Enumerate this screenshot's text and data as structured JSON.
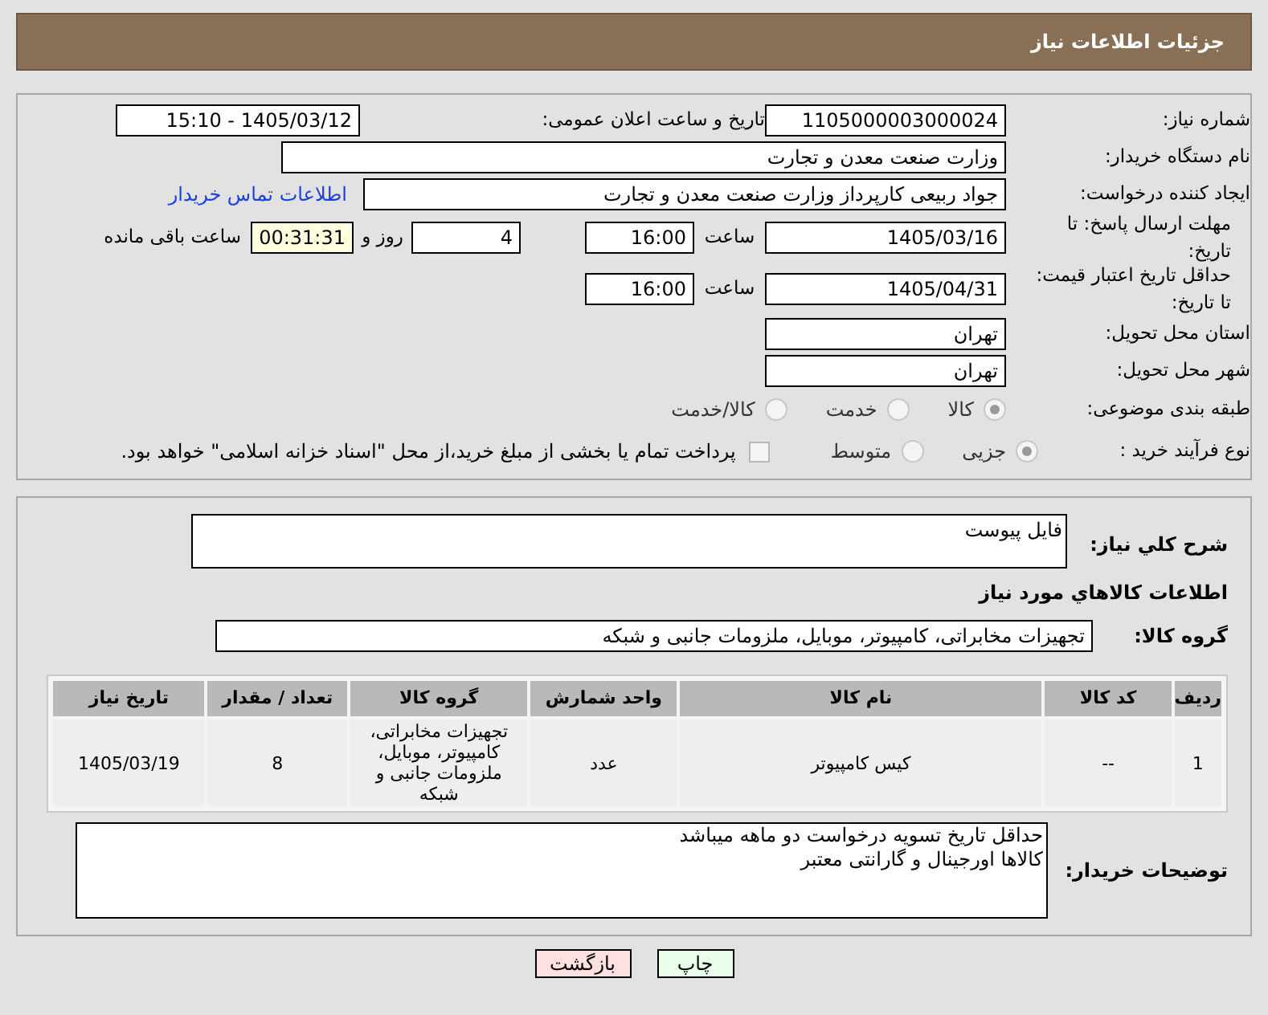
{
  "header": {
    "title": "جزئیات اطلاعات نیاز"
  },
  "need_number": {
    "label": "شماره نیاز:",
    "value": "1105000003000024"
  },
  "announce": {
    "label": "تاریخ و ساعت اعلان عمومی:",
    "value": "1405/03/12 - 15:10"
  },
  "buyer_org": {
    "label": "نام دستگاه خریدار:",
    "value": "وزارت صنعت معدن و تجارت"
  },
  "creator": {
    "label": "ایجاد کننده درخواست:",
    "value": "جواد ربیعی کارپرداز وزارت صنعت معدن و تجارت",
    "link": "اطلاعات تماس خریدار"
  },
  "reply_deadline": {
    "label": "مهلت ارسال پاسخ: تا تاریخ:",
    "date": "1405/03/16",
    "time_label": "ساعت",
    "time": "16:00",
    "days": "4",
    "days_label": "روز و",
    "remaining": "00:31:31",
    "remaining_label": "ساعت باقی مانده"
  },
  "price_validity": {
    "label": "حداقل تاریخ اعتبار قیمت: تا تاریخ:",
    "date": "1405/04/31",
    "time_label": "ساعت",
    "time": "16:00"
  },
  "province": {
    "label": "استان محل تحویل:",
    "value": "تهران"
  },
  "city": {
    "label": "شهر محل تحویل:",
    "value": "تهران"
  },
  "category": {
    "label": "طبقه بندی موضوعی:",
    "options": [
      {
        "label": "كالا",
        "selected": true
      },
      {
        "label": "خدمت",
        "selected": false
      },
      {
        "label": "كالا/خدمت",
        "selected": false
      }
    ]
  },
  "process": {
    "label": "نوع فرآیند خرید :",
    "options": [
      {
        "label": "جزیی",
        "selected": true
      },
      {
        "label": "متوسط",
        "selected": false
      }
    ],
    "payment": {
      "label": "پرداخت تمام یا بخشی از مبلغ خرید،از محل \"اسناد خزانه اسلامی\" خواهد بود.",
      "checked": false
    }
  },
  "description": {
    "label": "شرح کلي نیاز:",
    "value": "فایل پیوست"
  },
  "goods_title": "اطلاعات کالاهاي مورد نیاز",
  "goods_group": {
    "label": "گروه کالا:",
    "value": "تجهیزات مخابراتی، کامپیوتر، موبایل، ملزومات جانبی و شبکه"
  },
  "table": {
    "columns": [
      "ردیف",
      "کد کالا",
      "نام کالا",
      "واحد شمارش",
      "گروه کالا",
      "تعداد / مقدار",
      "تاریخ نیاز"
    ],
    "rows": [
      [
        "1",
        "--",
        "کیس کامپیوتر",
        "عدد",
        "تجهیزات مخابراتی، کامپیوتر، موبایل، ملزومات جانبی و شبکه",
        "8",
        "1405/03/19"
      ]
    ]
  },
  "buyer_notes": {
    "label": "توضیحات خریدار:",
    "lines": [
      "حداقل تاریخ تسویه درخواست دو ماهه میباشد",
      "کالاها اورجینال و گارانتی معتبر"
    ]
  },
  "buttons": [
    {
      "label": "چاپ",
      "kind": "print"
    },
    {
      "label": "بازگشت",
      "kind": "back"
    }
  ]
}
